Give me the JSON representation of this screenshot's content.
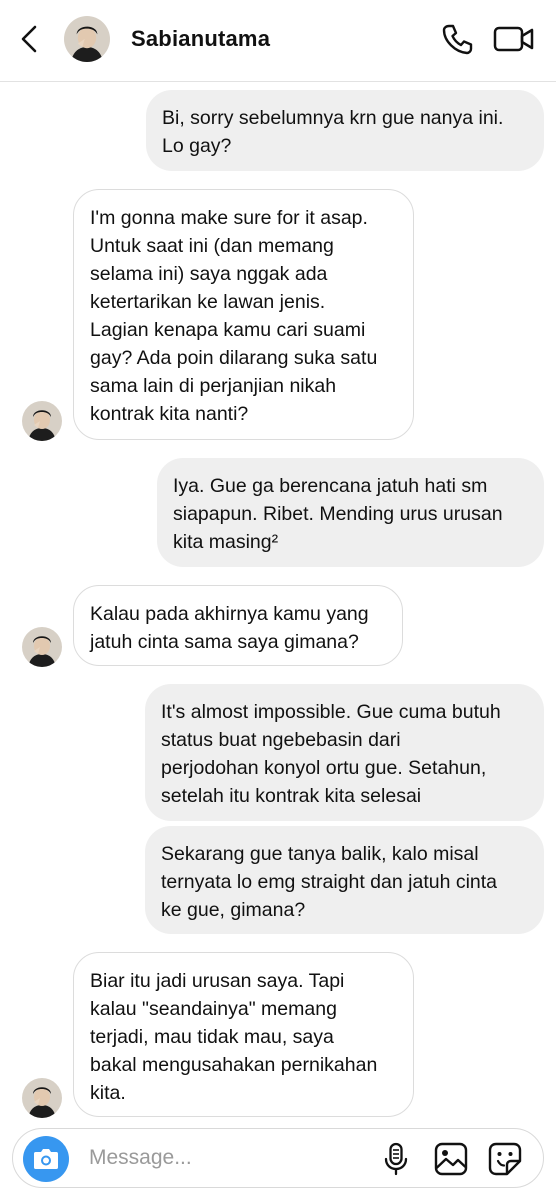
{
  "header": {
    "contact_name": "Sabianutama",
    "icons": [
      "back-arrow-icon",
      "contact-avatar",
      "phone-icon",
      "video-camera-icon"
    ]
  },
  "messages": [
    {
      "direction": "outgoing",
      "text": "Bi, sorry sebelumnya krn gue nanya ini.\nLo gay?"
    },
    {
      "direction": "incoming",
      "text": "I'm gonna make sure for it asap.\nUntuk saat ini (dan memang\nselama ini) saya nggak ada\nketertarikan ke lawan jenis.\nLagian kenapa kamu cari suami\ngay? Ada poin dilarang suka satu\nsama lain di perjanjian nikah\nkontrak kita nanti?"
    },
    {
      "direction": "outgoing",
      "text": "Iya. Gue ga berencana jatuh hati sm\nsiapapun. Ribet. Mending urus urusan\nkita masing²"
    },
    {
      "direction": "incoming",
      "text": "Kalau pada akhirnya kamu yang\njatuh cinta sama saya gimana?"
    },
    {
      "direction": "outgoing",
      "text": "It's almost impossible. Gue cuma butuh\nstatus buat ngebebasin dari\nperjodohan konyol ortu gue. Setahun,\nsetelah itu kontrak kita selesai"
    },
    {
      "direction": "outgoing",
      "text": "Sekarang gue tanya balik, kalo misal\nternyata lo emg straight dan jatuh cinta\nke gue, gimana?"
    },
    {
      "direction": "incoming",
      "text": "Biar itu jadi urusan saya. Tapi\nkalau \"seandainya\" memang\nterjadi, mau tidak mau, saya\nbakal mengusahakan pernikahan\nkita."
    }
  ],
  "composer": {
    "placeholder": "Message...",
    "value": "",
    "icons": [
      "camera-icon",
      "microphone-icon",
      "gallery-icon",
      "sticker-icon"
    ]
  },
  "colors": {
    "outgoing_bubble": "#efefef",
    "incoming_border": "#dcdcdc",
    "camera_button": "#3797f0",
    "placeholder": "#9a9a9a"
  }
}
